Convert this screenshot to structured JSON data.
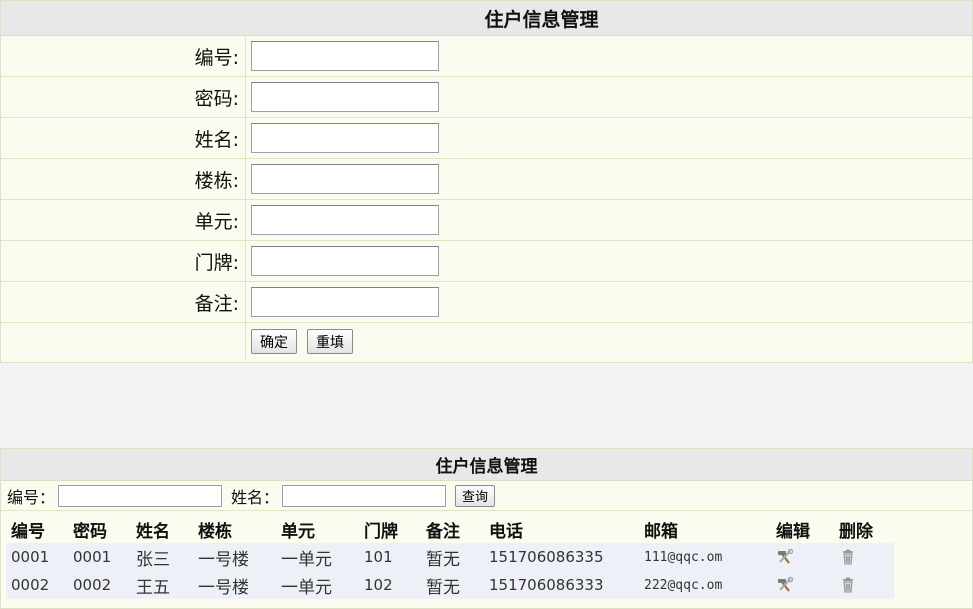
{
  "form": {
    "title": "住户信息管理",
    "fields": [
      {
        "label": "编号:",
        "value": ""
      },
      {
        "label": "密码:",
        "value": ""
      },
      {
        "label": "姓名:",
        "value": ""
      },
      {
        "label": "楼栋:",
        "value": ""
      },
      {
        "label": "单元:",
        "value": ""
      },
      {
        "label": "门牌:",
        "value": ""
      },
      {
        "label": "备注:",
        "value": ""
      }
    ],
    "confirm_label": "确定",
    "reset_label": "重填"
  },
  "list": {
    "title": "住户信息管理",
    "search": {
      "id_label": "编号：",
      "id_value": "",
      "name_label": "姓名：",
      "name_value": "",
      "query_label": "查询"
    },
    "columns": [
      "编号",
      "密码",
      "姓名",
      "楼栋",
      "单元",
      "门牌",
      "备注",
      "电话",
      "邮箱",
      "编辑",
      "删除"
    ],
    "rows": [
      {
        "id": "0001",
        "password": "0001",
        "name": "张三",
        "building": "一号楼",
        "unit": "一单元",
        "door": "101",
        "note": "暂无",
        "phone": "151706086335",
        "email": "111@qqc.om"
      },
      {
        "id": "0002",
        "password": "0002",
        "name": "王五",
        "building": "一号楼",
        "unit": "一单元",
        "door": "102",
        "note": "暂无",
        "phone": "151706086333",
        "email": "222@qqc.om"
      }
    ],
    "edit_icon": "hammer-wrench-icon",
    "delete_icon": "trash-can-icon"
  }
}
